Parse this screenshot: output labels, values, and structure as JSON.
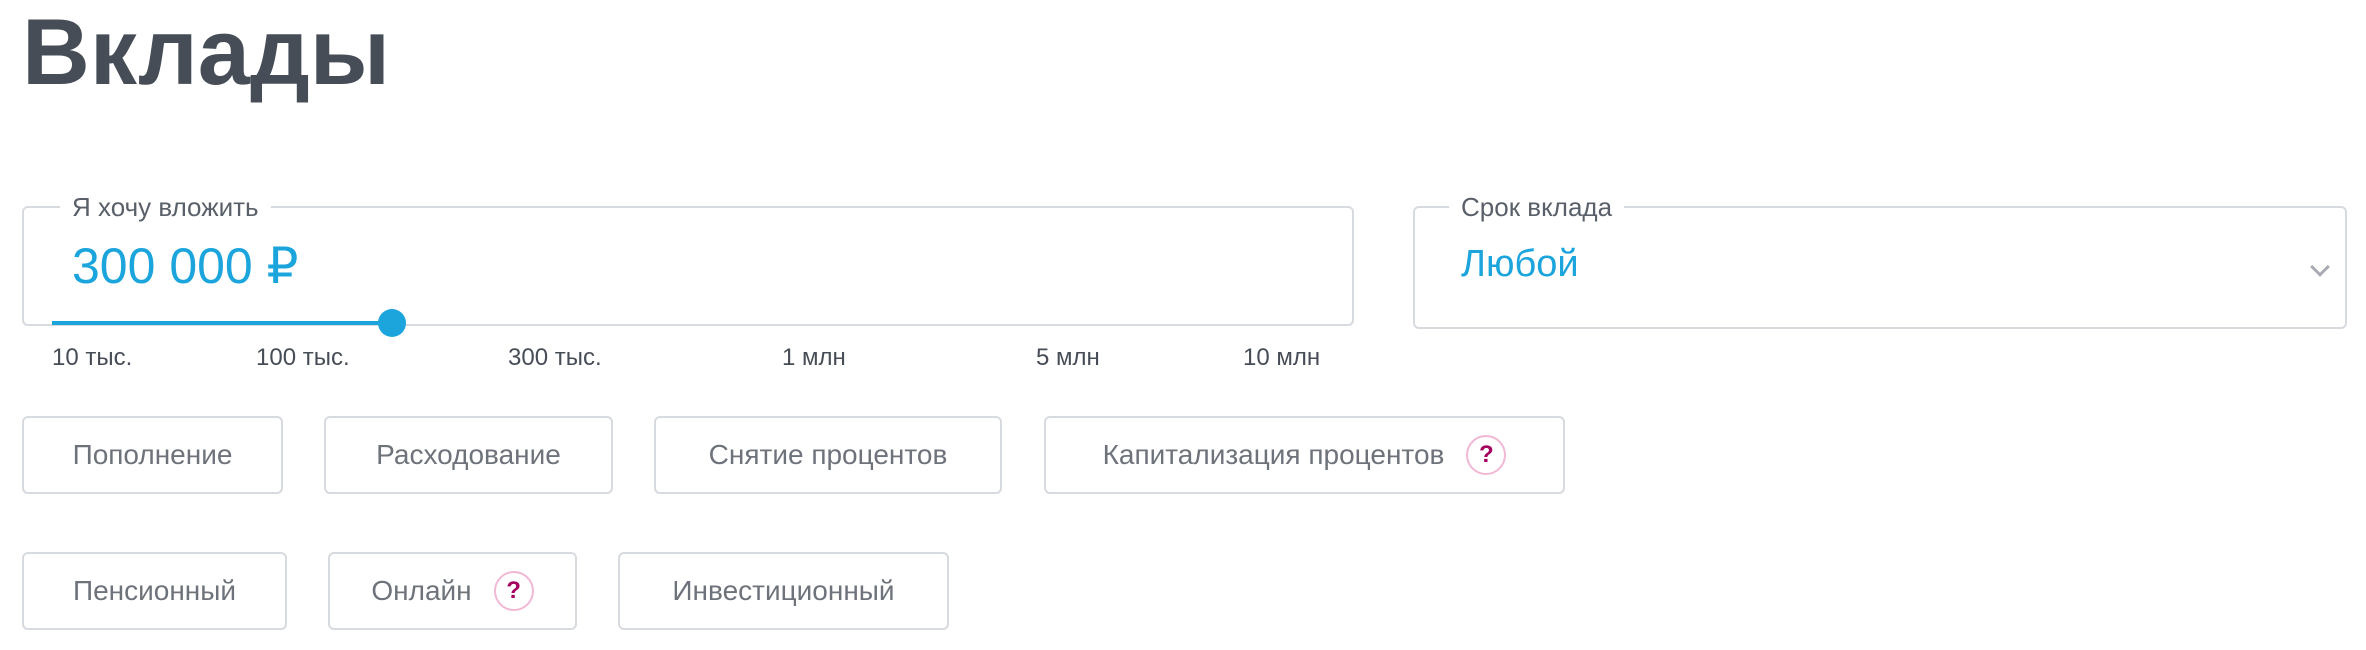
{
  "page": {
    "title": "Вклады"
  },
  "amount": {
    "legend": "Я хочу вложить",
    "value": "300 000 ₽",
    "slider_fraction": 0.267,
    "ticks": [
      "10 тыс.",
      "100 тыс.",
      "300 тыс.",
      "1 млн",
      "5 млн",
      "10 млн"
    ]
  },
  "term": {
    "legend": "Срок вклада",
    "value": "Любой",
    "icon": "chevron-down-icon"
  },
  "filters": {
    "row1": [
      {
        "label": "Пополнение"
      },
      {
        "label": "Расходование"
      },
      {
        "label": "Снятие процентов"
      },
      {
        "label": "Капитализация процентов",
        "help": "?"
      }
    ],
    "row2": [
      {
        "label": "Пенсионный"
      },
      {
        "label": "Онлайн",
        "help": "?"
      },
      {
        "label": "Инвестиционный"
      }
    ]
  },
  "colors": {
    "accent": "#1ba5dc",
    "help": "#a3005f",
    "title": "#474d56",
    "border": "#d7dadf"
  }
}
